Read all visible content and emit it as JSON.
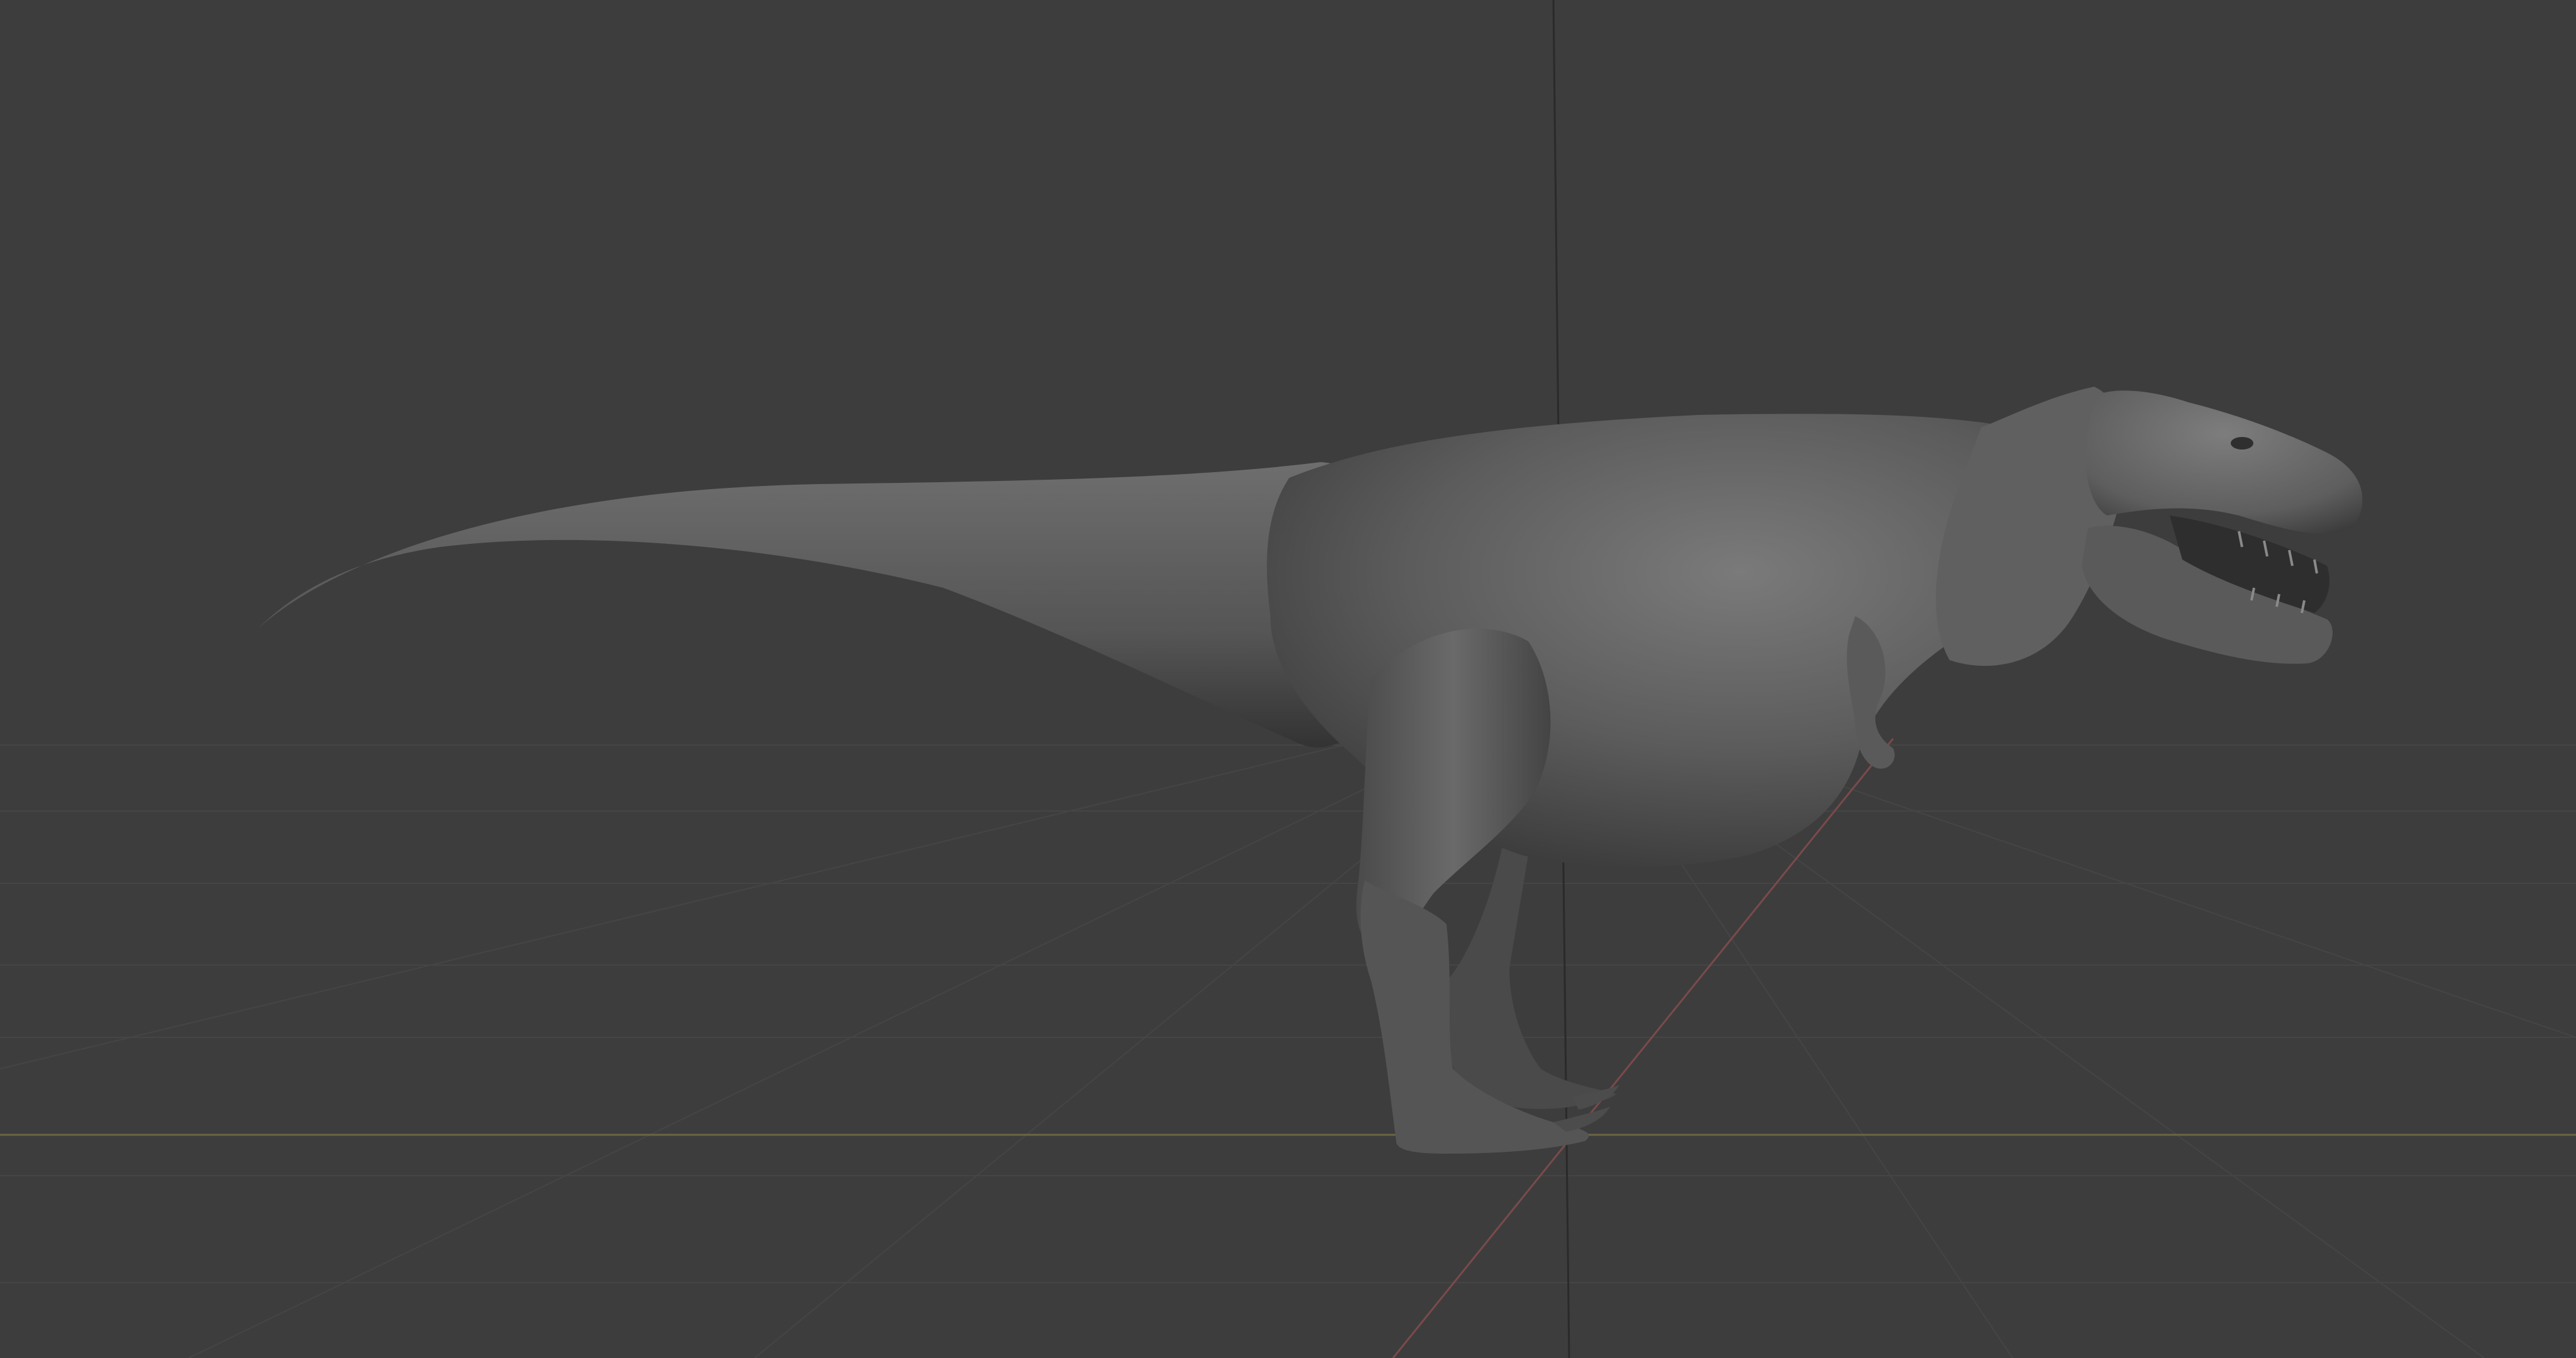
{
  "viewport": {
    "background_color": "#3d3d3d",
    "grid_line_color": "#454545",
    "floor_line_color": "#4a4a4a",
    "x_axis_color": "#6b6644",
    "y_axis_color": "#7a4a4c",
    "z_axis_color": "#2e2e2e",
    "model_base_color": "#5c5c5c",
    "model_highlight_color": "#7a7a7a",
    "model_shadow_color": "#2f2f2f"
  },
  "scene": {
    "model_name": "tyrannosaurus-sculpt",
    "view_type": "side-view",
    "grid_visible": true,
    "axes_visible": true
  }
}
